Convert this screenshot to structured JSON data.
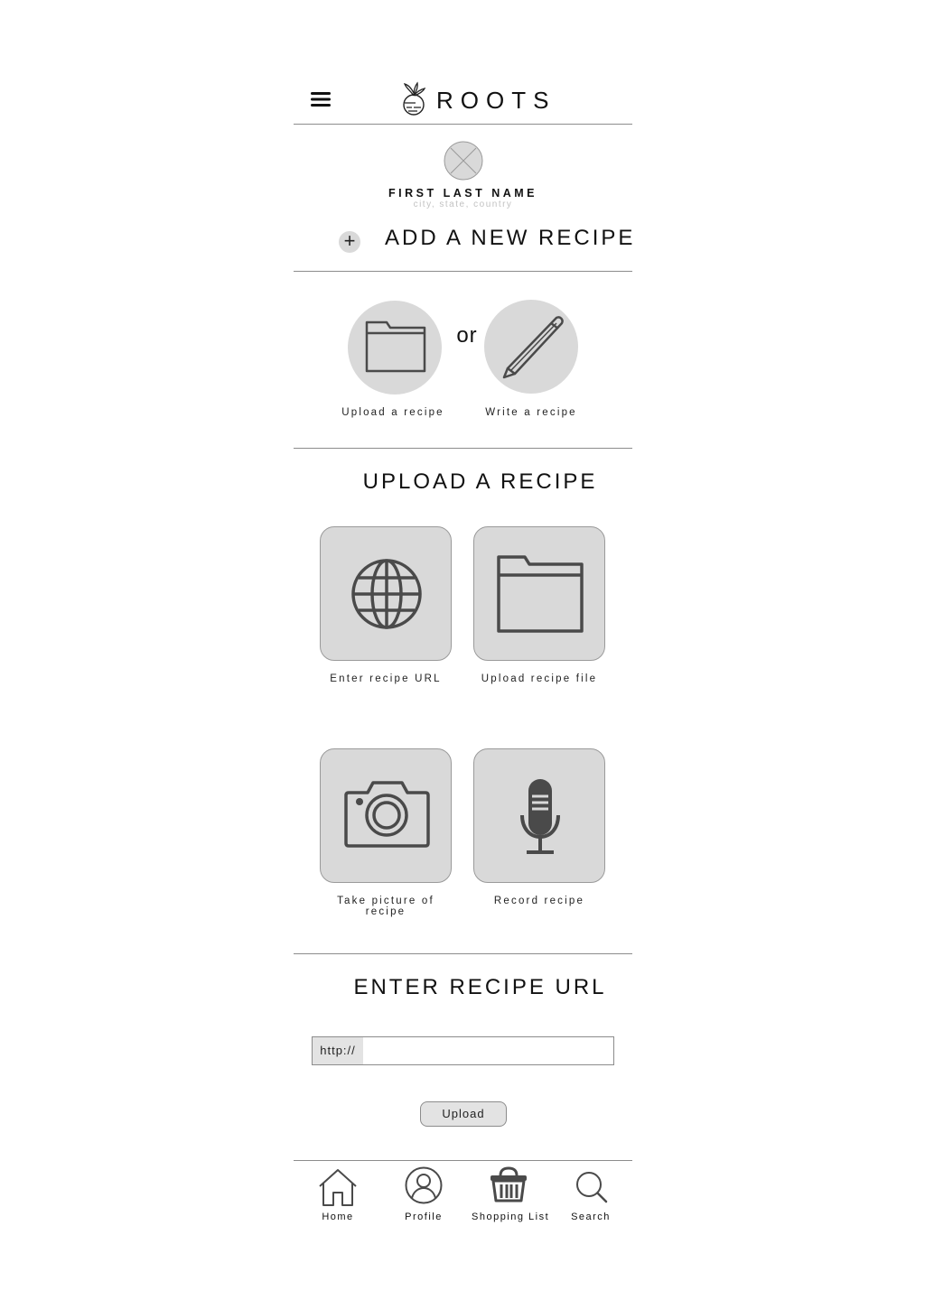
{
  "header": {
    "brand": "ROOTS",
    "menu_icon": "hamburger-menu-icon",
    "logo_icon": "beet-icon"
  },
  "profile": {
    "name": "FIRST LAST NAME",
    "location": "city, state, country",
    "avatar_icon": "avatar-placeholder-icon"
  },
  "add_recipe": {
    "plus_symbol": "+",
    "title": "ADD A NEW RECIPE",
    "options": [
      {
        "label": "Upload a recipe",
        "icon": "folder-icon"
      },
      {
        "label": "Write a recipe",
        "icon": "pencil-icon"
      }
    ],
    "or_text": "or"
  },
  "upload_section": {
    "title": "UPLOAD A RECIPE",
    "tiles": [
      {
        "label": "Enter recipe URL",
        "icon": "globe-icon"
      },
      {
        "label": "Upload recipe file",
        "icon": "folder-icon"
      },
      {
        "label": "Take picture of recipe",
        "icon": "camera-icon"
      },
      {
        "label": "Record recipe",
        "icon": "microphone-icon"
      }
    ]
  },
  "url_section": {
    "title": "ENTER RECIPE URL",
    "prefix": "http://",
    "input_value": "",
    "upload_label": "Upload"
  },
  "bottom_nav": {
    "items": [
      {
        "label": "Home",
        "icon": "home-icon"
      },
      {
        "label": "Profile",
        "icon": "profile-icon"
      },
      {
        "label": "Shopping List",
        "icon": "basket-icon"
      },
      {
        "label": "Search",
        "icon": "search-icon"
      }
    ]
  },
  "colors": {
    "tile_fill": "#d9d9d9",
    "icon_stroke": "#4a4a4a",
    "divider": "#8c8c8c"
  }
}
